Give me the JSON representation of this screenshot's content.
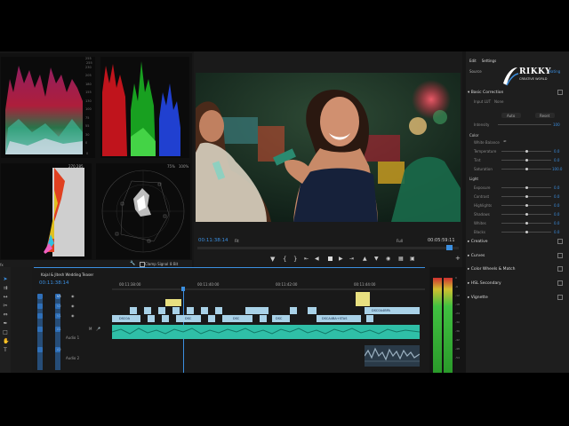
{
  "scopes": {
    "vectorscope_labels": [
      "75%",
      "100%"
    ],
    "parade_scale": [
      "255",
      "230",
      "205",
      "180",
      "155",
      "130",
      "100",
      "75",
      "55",
      "30",
      "0"
    ],
    "footer": {
      "clamp_signal": "Clamp Signal",
      "bit_depth": "8 Bit"
    }
  },
  "program_monitor": {
    "timecode": "00:11:38:14",
    "zoom": "Fit",
    "quality": "Full",
    "duration": "00:05:59:11"
  },
  "timeline": {
    "sequence_name": "Kajal & Jitesh Wedding Teaser",
    "timecode": "00:11:38:14",
    "ruler_marks": [
      "00:11:38:00",
      "00:11:40:00",
      "00:11:42:00",
      "00:11:44:00"
    ],
    "tracks": [
      "V3",
      "V2",
      "V1",
      "A1",
      "A2"
    ],
    "track_names": {
      "a1": "Audio 1",
      "a2": "Audio 2"
    },
    "clip_labels": [
      "DSC0A",
      "DSC",
      "DSC",
      "DSC",
      "DSCA4BA+STAS",
      "DSC0A4BPA"
    ]
  },
  "left_tools_label": "fx",
  "lumetri": {
    "tabs": [
      "Edit",
      "Settings"
    ],
    "source_label": "Source",
    "truncated_text": "Hating",
    "logo": {
      "main": "RIKKY",
      "sub": "CREATIVE WORLD"
    },
    "basic_correction": "Basic Correction",
    "input_lut": "Input LUT",
    "input_lut_value": "None",
    "intensity": "Intensity",
    "intensity_value": "100",
    "hdr_buttons": [
      "Auto",
      "Reset"
    ],
    "color_title": "Color",
    "white_balance": "White Balance",
    "color_params": [
      {
        "label": "Temperature",
        "value": "0.0"
      },
      {
        "label": "Tint",
        "value": "0.0"
      },
      {
        "label": "Saturation",
        "value": "100.0"
      }
    ],
    "light_title": "Light",
    "light_params": [
      {
        "label": "Exposure",
        "value": "0.0"
      },
      {
        "label": "Contrast",
        "value": "0.0"
      },
      {
        "label": "Highlights",
        "value": "0.0"
      },
      {
        "label": "Shadows",
        "value": "0.0"
      },
      {
        "label": "Whites",
        "value": "0.0"
      },
      {
        "label": "Blacks",
        "value": "0.0"
      }
    ],
    "sections": [
      "Creative",
      "Curves",
      "Color Wheels & Match",
      "HSL Secondary",
      "Vignette"
    ]
  },
  "meter_scale": [
    "0",
    "-6",
    "-12",
    "-18",
    "-24",
    "-30",
    "-36",
    "-42",
    "-48",
    "-54"
  ]
}
